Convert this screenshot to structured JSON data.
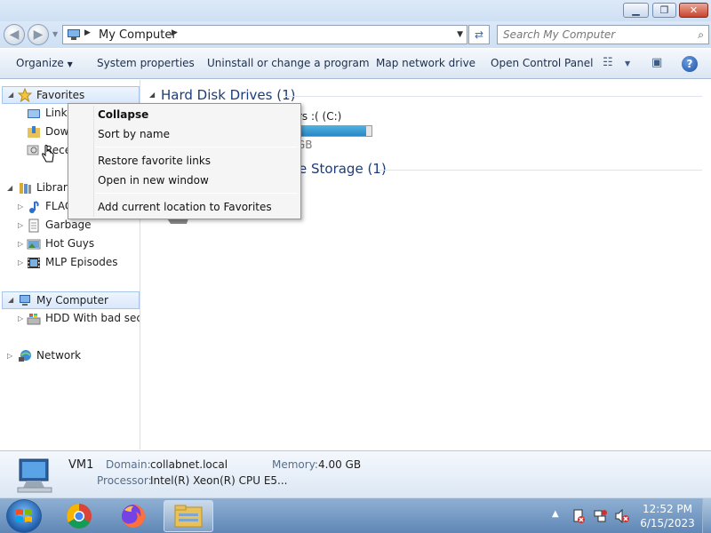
{
  "window": {
    "minimize_icon": "minimize-icon",
    "maximize_icon": "maximize-icon",
    "close_icon": "close-icon"
  },
  "address_bar": {
    "path": "My Computer",
    "search_placeholder": "Search My Computer"
  },
  "toolbar": {
    "organize": "Organize",
    "system_properties": "System properties",
    "uninstall": "Uninstall or change a program",
    "map_drive": "Map network drive",
    "control_panel": "Open Control Panel",
    "help_glyph": "?"
  },
  "nav": {
    "favorites": "Favorites",
    "links": "Links",
    "downloads": "Dow",
    "recent": "Rece",
    "libraries": "Librari",
    "flac": "FLAC",
    "garbage": "Garbage",
    "hot_guys": "Hot Guys",
    "mlp": "MLP Episodes",
    "my_computer": "My Computer",
    "hdd": "HDD With bad secto",
    "network": "Network"
  },
  "main": {
    "group1": "Hard Disk Drives (1)",
    "group2_fragment": "e Storage (1)",
    "drive_name_fragment": "rs :( (C:)",
    "drive_size_fragment": "GB",
    "drive_used_fraction": 0.93
  },
  "context_menu": {
    "collapse": "Collapse",
    "sort_by_name": "Sort by name",
    "restore": "Restore favorite links",
    "open_new": "Open in new window",
    "add_current": "Add current location to Favorites"
  },
  "details": {
    "name": "VM1",
    "domain_key": "Domain:",
    "domain_val": "collabnet.local",
    "memory_key": "Memory:",
    "memory_val": "4.00 GB",
    "processor_key": "Processor:",
    "processor_val": "Intel(R) Xeon(R) CPU E5..."
  },
  "taskbar": {
    "time": "12:52 PM",
    "date": "6/15/2023"
  }
}
